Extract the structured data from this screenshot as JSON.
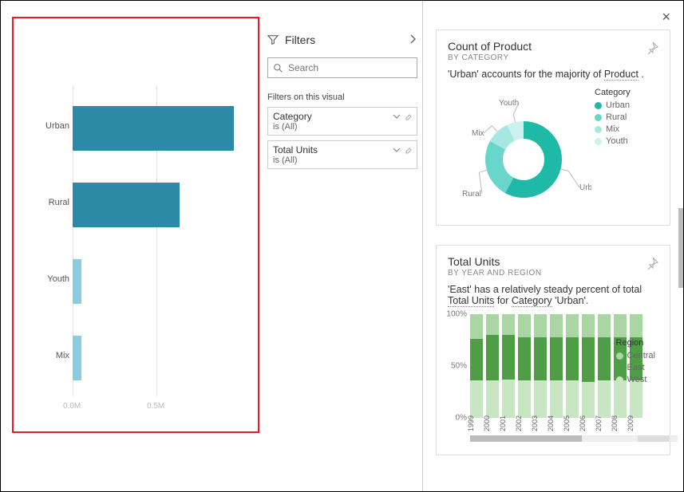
{
  "chart_data": [
    {
      "type": "bar",
      "orientation": "horizontal",
      "categories": [
        "Urban",
        "Rural",
        "Youth",
        "Mix"
      ],
      "values": [
        0.96,
        0.64,
        0.05,
        0.05
      ],
      "xlabel": "",
      "ylabel": "",
      "xticks": [
        "0.0M",
        "0.5M"
      ],
      "xlim": [
        0,
        1.0
      ],
      "colors": [
        "#2c8aa6",
        "#2c8aa6",
        "#8bcce1",
        "#8bcce1"
      ]
    },
    {
      "type": "pie",
      "style": "donut",
      "title": "Count of Product",
      "subtitle": "BY CATEGORY",
      "description_pre": "'Urban' accounts for the majority of ",
      "description_link": "Product",
      "description_post": " .",
      "legend_title": "Category",
      "series": [
        {
          "name": "Urban",
          "value": 58,
          "color": "#1fb9a8"
        },
        {
          "name": "Rural",
          "value": 25,
          "color": "#68d6cb"
        },
        {
          "name": "Mix",
          "value": 10,
          "color": "#a6e8e1"
        },
        {
          "name": "Youth",
          "value": 7,
          "color": "#cdf2ee"
        }
      ]
    },
    {
      "type": "bar",
      "style": "stacked-100",
      "title": "Total Units",
      "subtitle": "BY YEAR AND REGION",
      "description_parts": [
        "'East' has a relatively steady percent of total ",
        "Total Units",
        " for ",
        "Category",
        " 'Urban'."
      ],
      "legend_title": "Region",
      "categories": [
        "1999",
        "2000",
        "2001",
        "2002",
        "2003",
        "2004",
        "2005",
        "2006",
        "2007",
        "2008",
        "2009"
      ],
      "yticks": [
        "0%",
        "50%",
        "100%"
      ],
      "ylim": [
        0,
        100
      ],
      "series": [
        {
          "name": "Central",
          "color": "#a9d6a2",
          "values": [
            24,
            20,
            20,
            22,
            22,
            22,
            22,
            22,
            22,
            22,
            22
          ]
        },
        {
          "name": "East",
          "color": "#4f9e46",
          "values": [
            40,
            44,
            43,
            42,
            42,
            42,
            42,
            43,
            42,
            42,
            42
          ]
        },
        {
          "name": "West",
          "color": "#c9e6c3",
          "values": [
            36,
            36,
            37,
            36,
            36,
            36,
            36,
            35,
            36,
            36,
            36
          ]
        }
      ]
    }
  ],
  "filters": {
    "title": "Filters",
    "search_placeholder": "Search",
    "section_label": "Filters on this visual",
    "cards": [
      {
        "name": "Category",
        "sub": "is (All)"
      },
      {
        "name": "Total Units",
        "sub": "is (All)"
      }
    ]
  },
  "donut_labels": [
    "Urban",
    "Rural",
    "Mix",
    "Youth"
  ]
}
